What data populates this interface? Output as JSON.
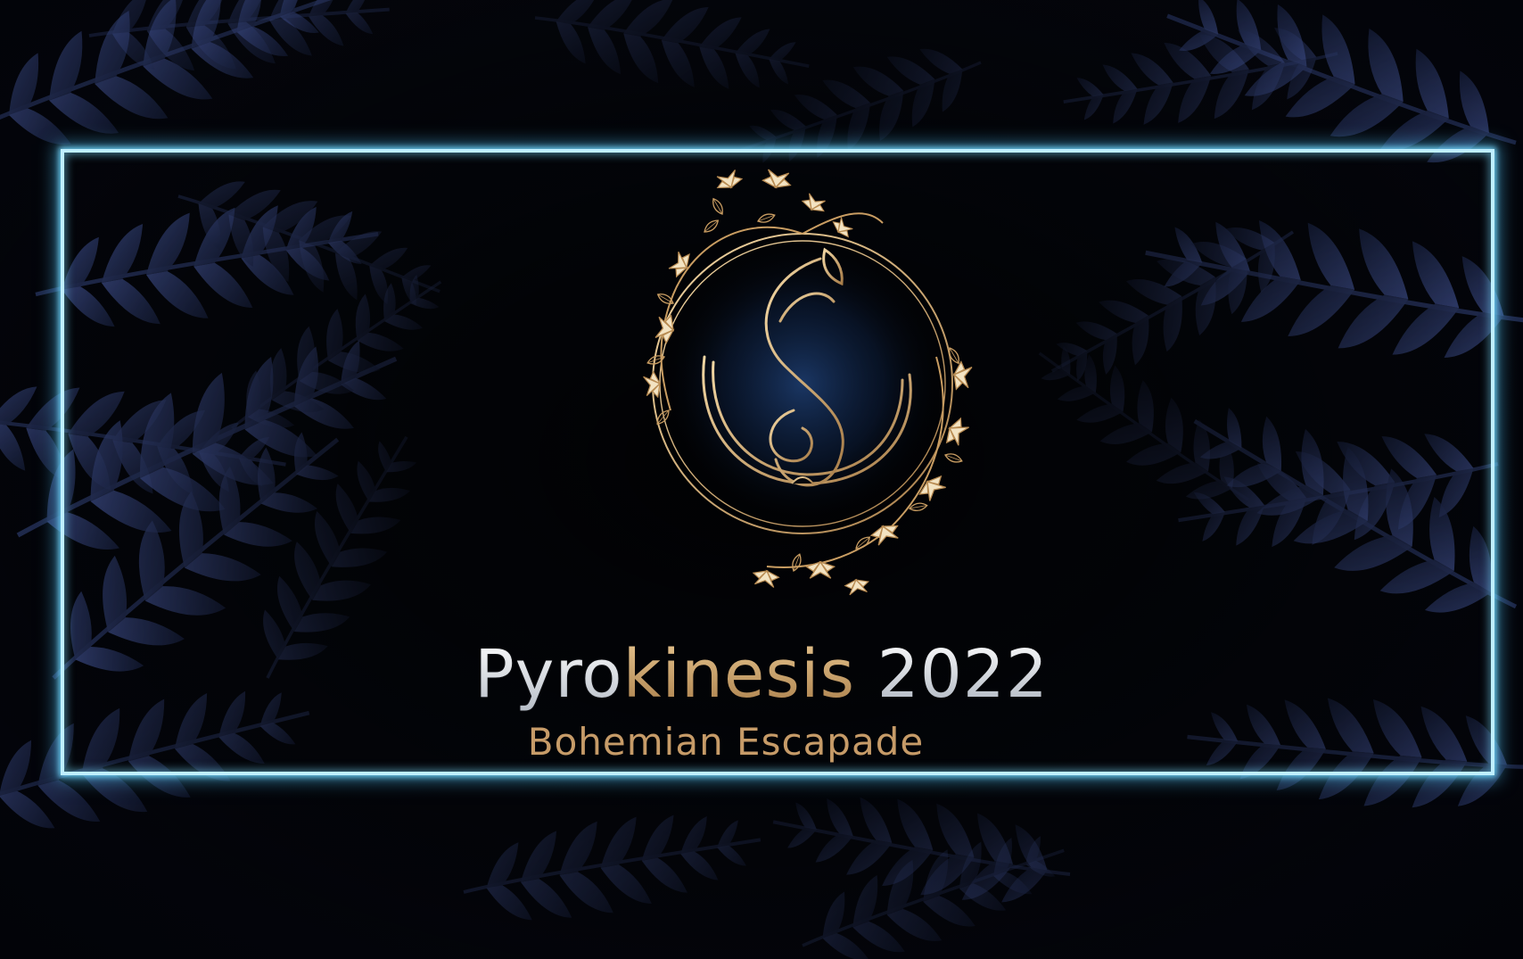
{
  "banner": {
    "title_part1": "Pyro",
    "title_part2": "kinesis",
    "title_part3": "2022",
    "subtitle": "Bohemian Escapade"
  },
  "colors": {
    "neon_frame": "#bfefff",
    "gold": "#c9a472",
    "silver": "#e9edf2",
    "background": "#04060c",
    "fern": "#3b4a86"
  },
  "icons": {
    "emblem": "flame-crescent-logo-icon",
    "wreath": "floral-wreath-icon",
    "background": "fern-leaves-icon"
  }
}
